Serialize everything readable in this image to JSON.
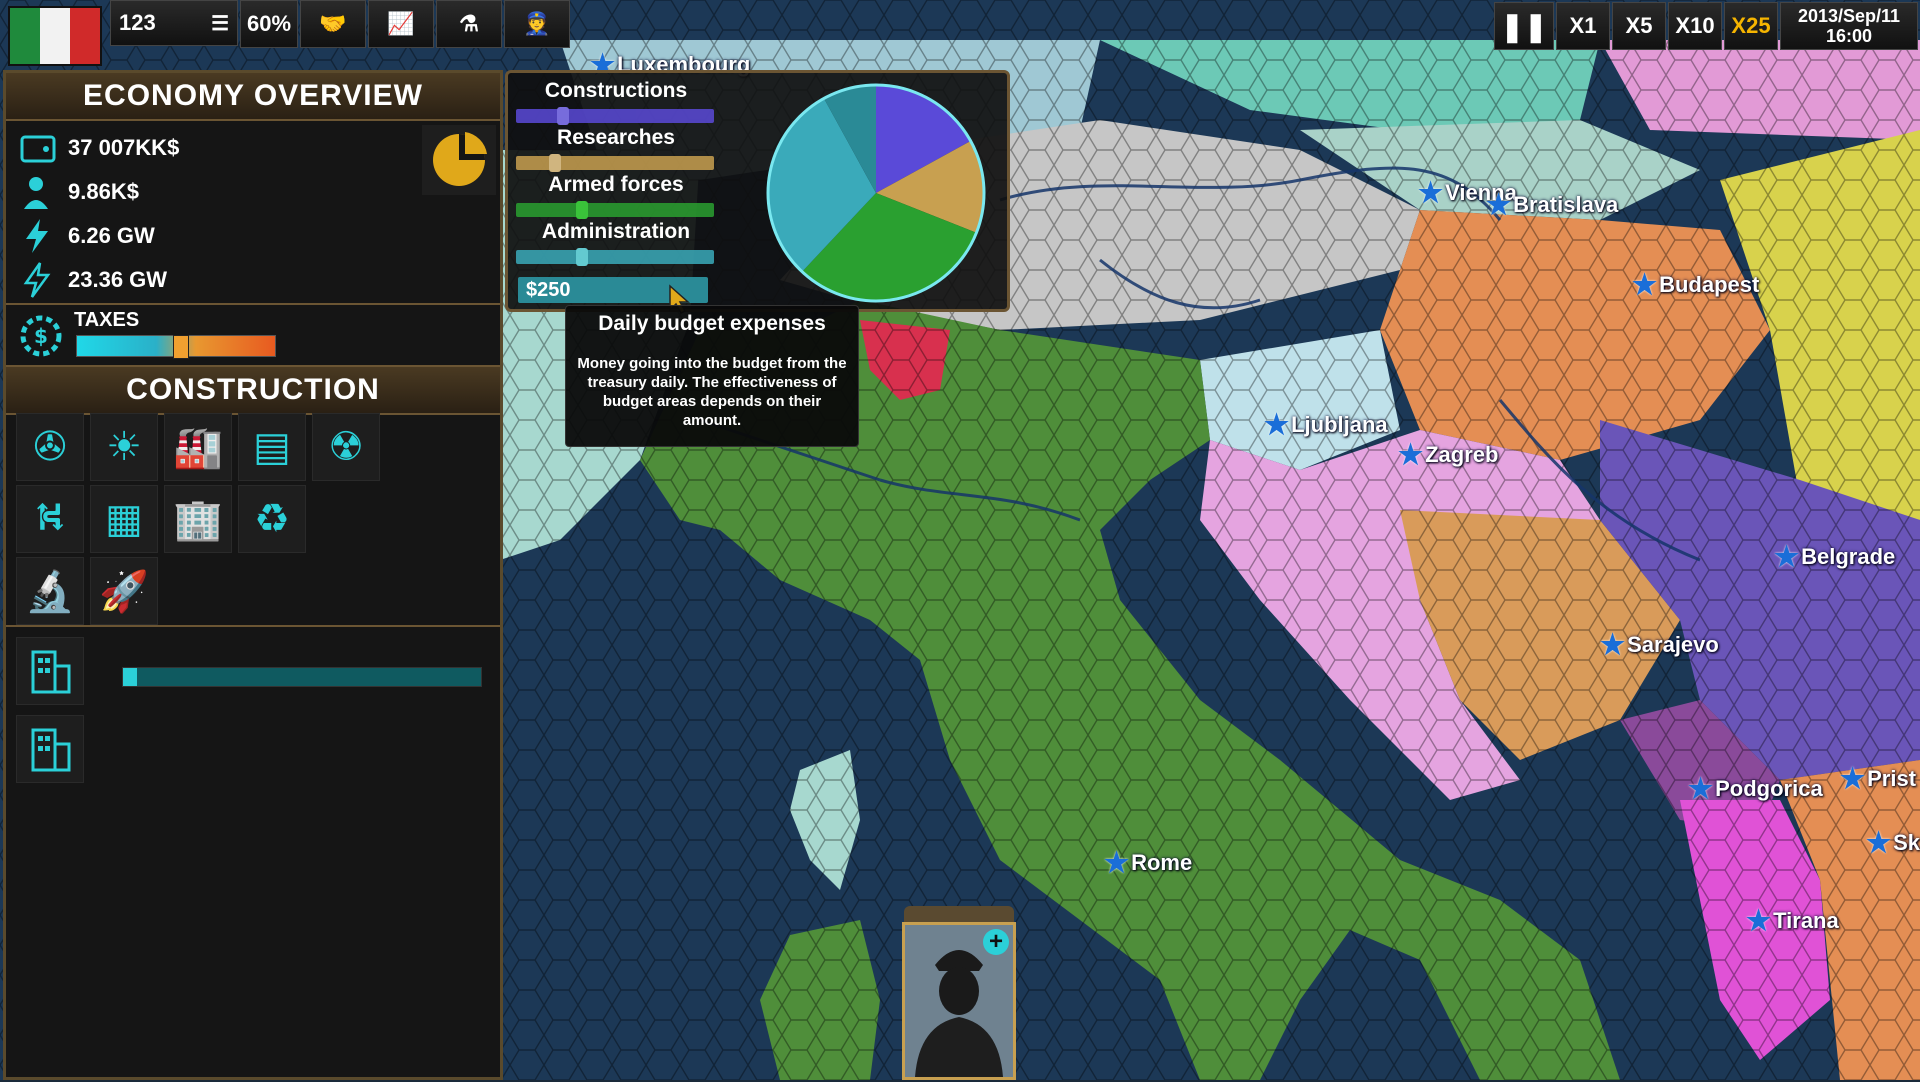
{
  "topbar": {
    "population": "123",
    "approval": "60%",
    "speed_buttons": [
      "X1",
      "X5",
      "X10",
      "X25"
    ],
    "active_speed": "X25",
    "date": "2013/Sep/11",
    "time": "16:00",
    "active_color": "#f5b400"
  },
  "economy": {
    "title": "ECONOMY OVERVIEW",
    "money": "37 007KK$",
    "income": "9.86K$",
    "energy_produced": "6.26 GW",
    "energy_consumed": "23.36 GW",
    "taxes_label": "TAXES",
    "taxes_level": 0.52
  },
  "construction": {
    "title": "CONSTRUCTION",
    "icons": [
      "wind-turbine-icon",
      "solar-panel-icon",
      "factory-icon",
      "farm-icon",
      "nuclear-icon",
      "road-icon",
      "construction-site-icon",
      "office-building-icon",
      "recycle-icon",
      "research-lab-icon",
      "rocket-icon"
    ],
    "queue_progress": 0.02
  },
  "budget": {
    "items": [
      {
        "label": "Constructions",
        "color": "#5a4ad8",
        "level": 0.22
      },
      {
        "label": "Researches",
        "color": "#c8a050",
        "level": 0.18
      },
      {
        "label": "Armed forces",
        "color": "#2aa030",
        "level": 0.32
      },
      {
        "label": "Administration",
        "color": "#3aaaba",
        "level": 0.32
      }
    ],
    "amount": "$250",
    "pie_shares": [
      0.17,
      0.14,
      0.31,
      0.3,
      0.08
    ]
  },
  "tooltip": {
    "title": "Daily budget expenses",
    "body": "Money going into the budget from the treasury daily. The effectiveness of budget areas depends on their amount."
  },
  "cities": [
    "Luxembourg",
    "Vienna",
    "Bratislava",
    "Budapest",
    "Ljubljana",
    "Zagreb",
    "Belgrade",
    "Sarajevo",
    "Rome",
    "Podgorica",
    "Prist",
    "Tirana",
    "Sk"
  ],
  "colors": {
    "panel_border": "#6b5533",
    "accent_cyan": "#2bd0d8"
  }
}
